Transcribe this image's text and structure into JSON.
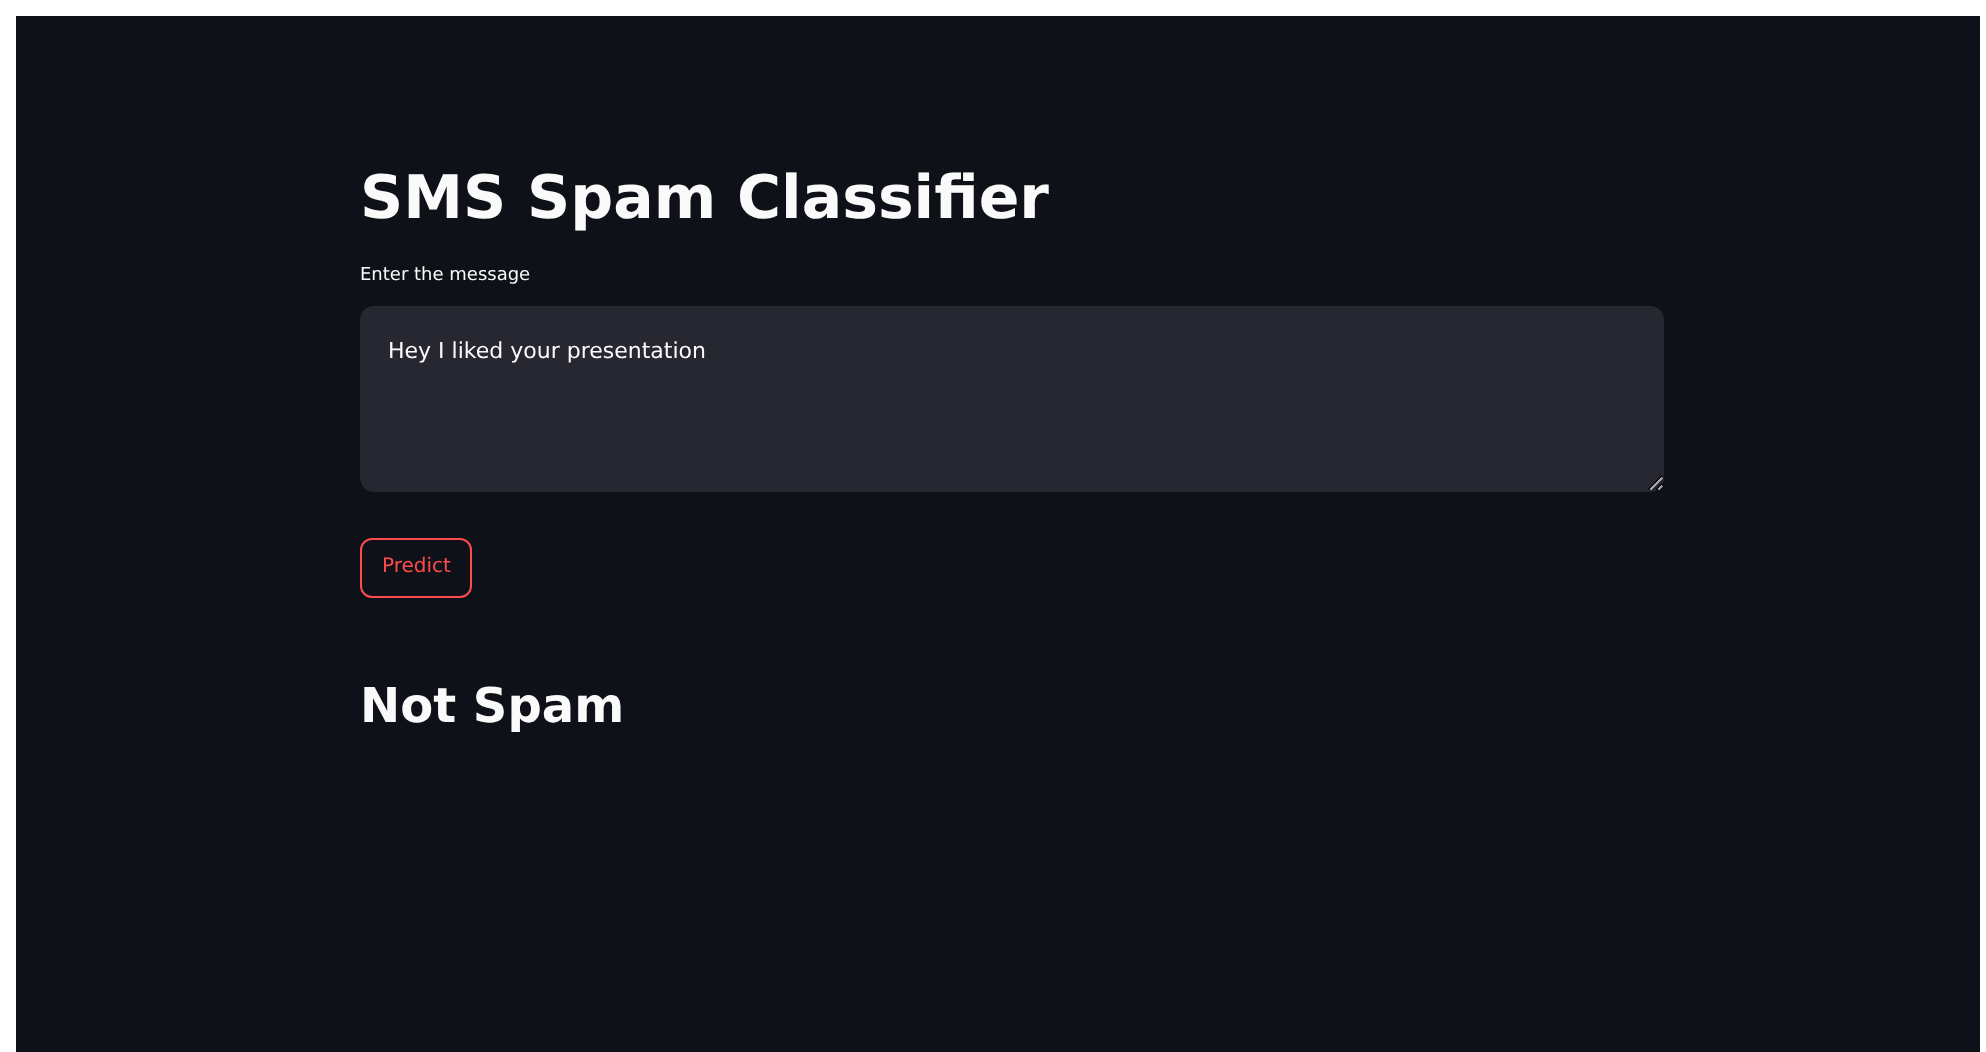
{
  "title": "SMS Spam Classifier",
  "message_field": {
    "label": "Enter the message",
    "value": "Hey I liked your presentation"
  },
  "predict_button": {
    "label": "Predict"
  },
  "result": "Not Spam"
}
